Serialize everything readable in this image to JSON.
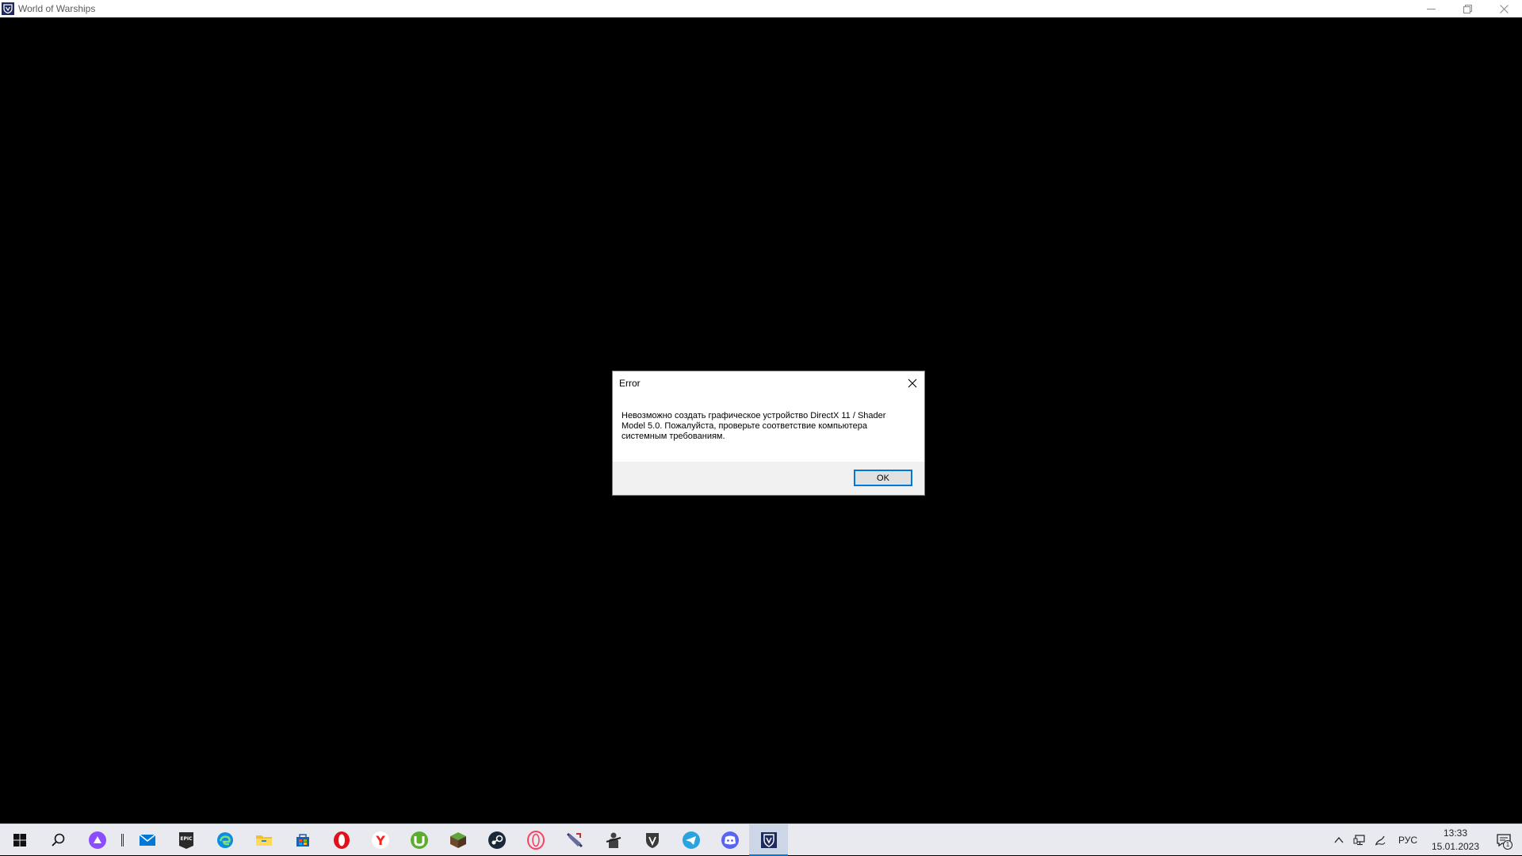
{
  "window": {
    "title": "World of Warships",
    "controls": {
      "minimize": "–",
      "restore": "❐",
      "close": "✕"
    }
  },
  "dialog": {
    "title": "Error",
    "message": "Невозможно создать графическое устройство DirectX 11 / Shader Model 5.0. Пожалуйста, проверьте соответствие компьютера системным требованиям.",
    "ok_label": "OK"
  },
  "taskbar": {
    "items": [
      {
        "icon": "windows-start-icon",
        "color": "#000000"
      },
      {
        "icon": "search-icon",
        "color": "#000000"
      },
      {
        "icon": "alice-assistant-icon",
        "color": "#8a4dff"
      },
      {
        "icon": "mail-icon",
        "color": "#0078d7"
      },
      {
        "icon": "epic-games-icon",
        "color": "#2a2a2a"
      },
      {
        "icon": "edge-icon",
        "color": "#0c8ee0"
      },
      {
        "icon": "file-explorer-icon",
        "color": "#f2c029"
      },
      {
        "icon": "store-icon",
        "color": "#1e5fb0"
      },
      {
        "icon": "opera-icon",
        "color": "#e0111b"
      },
      {
        "icon": "yandex-browser-icon",
        "color": "#ff1e1e"
      },
      {
        "icon": "utorrent-icon",
        "color": "#5bad2e"
      },
      {
        "icon": "minecraft-icon",
        "color": "#3e7d2c"
      },
      {
        "icon": "steam-icon",
        "color": "#1b2838"
      },
      {
        "icon": "opera-gx-icon",
        "color": "#ff4060"
      },
      {
        "icon": "ship-game-icon",
        "color": "#3a3a6a"
      },
      {
        "icon": "soldier-game-icon",
        "color": "#404040"
      },
      {
        "icon": "wargaming-shield-icon",
        "color": "#3a3a3a"
      },
      {
        "icon": "telegram-icon",
        "color": "#2aa3df"
      },
      {
        "icon": "discord-icon",
        "color": "#5865f2"
      },
      {
        "icon": "world-of-warships-icon",
        "color": "#1d2a5e"
      }
    ],
    "tray": {
      "language": "РУС",
      "time": "13:33",
      "date": "15.01.2023",
      "notification_count": "1"
    }
  }
}
